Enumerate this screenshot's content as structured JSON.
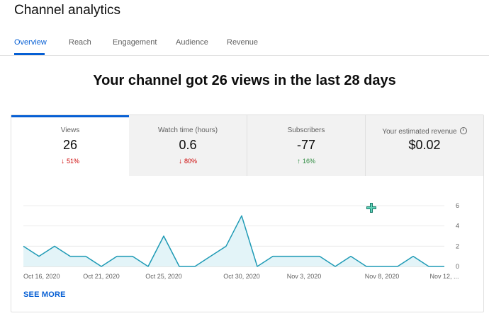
{
  "page": {
    "title": "Channel analytics"
  },
  "tabs": [
    {
      "label": "Overview"
    },
    {
      "label": "Reach"
    },
    {
      "label": "Engagement"
    },
    {
      "label": "Audience"
    },
    {
      "label": "Revenue"
    }
  ],
  "headline": "Your channel got 26 views in the last 28 days",
  "metrics": [
    {
      "label": "Views",
      "value": "26",
      "delta": "51%",
      "direction": "down"
    },
    {
      "label": "Watch time (hours)",
      "value": "0.6",
      "delta": "80%",
      "direction": "down"
    },
    {
      "label": "Subscribers",
      "value": "-77",
      "delta": "16%",
      "direction": "up"
    },
    {
      "label": "Your estimated revenue",
      "value": "$0.02",
      "icon": "clock-icon"
    }
  ],
  "see_more": "SEE MORE",
  "colors": {
    "accent": "#065fd4",
    "line": "#1e9ab5",
    "fill": "#e3f4f8",
    "down": "#cc0000",
    "up": "#2b8a3e"
  },
  "chart_data": {
    "type": "area",
    "series": [
      {
        "values": [
          2,
          1,
          2,
          1,
          1,
          0,
          1,
          1,
          0,
          3,
          0,
          0,
          1,
          2,
          5,
          0,
          1,
          1,
          1,
          1,
          0,
          1,
          0,
          0,
          0,
          1,
          0,
          0
        ]
      }
    ],
    "x_tick_labels": [
      "Oct 16, 2020",
      "Oct 21, 2020",
      "Oct 25, 2020",
      "Oct 30, 2020",
      "Nov 3, 2020",
      "Nov 8, 2020",
      "Nov 12, ..."
    ],
    "x_tick_index": [
      0,
      5,
      9,
      14,
      18,
      23,
      27
    ],
    "y_ticks": [
      0,
      2,
      4,
      6
    ],
    "ylim": [
      0,
      6
    ],
    "grid": true
  }
}
